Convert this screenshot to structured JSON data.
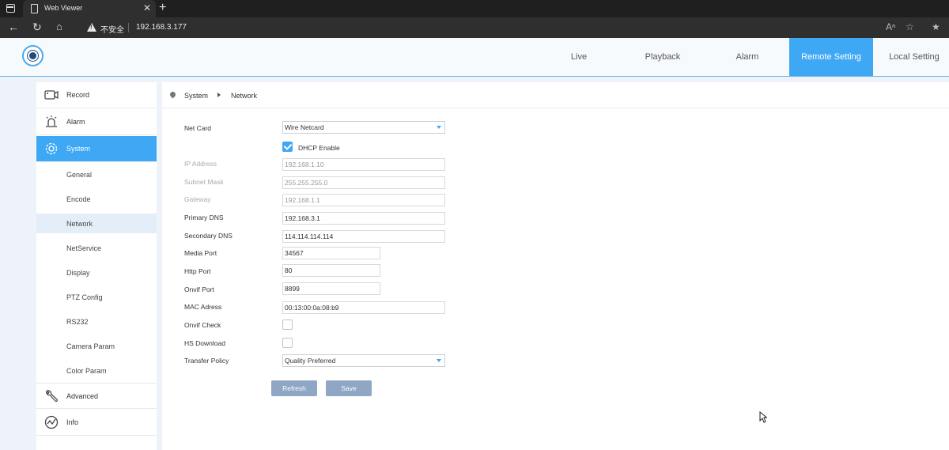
{
  "browser": {
    "tab_title": "Web Viewer",
    "tab_close": "✕",
    "new_tab": "+",
    "security_label": "不安全",
    "url": "192.168.3.177"
  },
  "header": {
    "tabs": [
      {
        "label": "Live"
      },
      {
        "label": "Playback"
      },
      {
        "label": "Alarm"
      },
      {
        "label": "Remote Setting"
      },
      {
        "label": "Local Setting"
      }
    ],
    "active_tab": "Remote Setting",
    "accent_color": "#3fa8f4"
  },
  "sidebar": {
    "items": [
      {
        "label": "Record",
        "icon": "camera-icon"
      },
      {
        "label": "Alarm",
        "icon": "alarm-icon"
      },
      {
        "label": "System",
        "icon": "gear-icon"
      },
      {
        "label": "Advanced",
        "icon": "wrench-icon"
      },
      {
        "label": "Info",
        "icon": "info-chart-icon"
      }
    ],
    "system_subitems": [
      {
        "label": "General"
      },
      {
        "label": "Encode"
      },
      {
        "label": "Network"
      },
      {
        "label": "NetService"
      },
      {
        "label": "Display"
      },
      {
        "label": "PTZ Config"
      },
      {
        "label": "RS232"
      },
      {
        "label": "Camera Param"
      },
      {
        "label": "Color Param"
      }
    ],
    "active_subitem": "Network"
  },
  "breadcrumb": {
    "level1": "System",
    "level2": "Network"
  },
  "form": {
    "net_card_label": "Net Card",
    "net_card_value": "Wire Netcard",
    "dhcp_label": "DHCP Enable",
    "dhcp_checked": true,
    "ip_label": "IP Address",
    "ip_value": "192.168.1.10",
    "mask_label": "Subnet Mask",
    "mask_value": "255.255.255.0",
    "gateway_label": "Gateway",
    "gateway_value": "192.168.1.1",
    "dns1_label": "Primary DNS",
    "dns1_value": "192.168.3.1",
    "dns2_label": "Secondary DNS",
    "dns2_value": "114.114.114.114",
    "media_port_label": "Media Port",
    "media_port_value": "34567",
    "http_port_label": "Http Port",
    "http_port_value": "80",
    "onvif_port_label": "Onvif Port",
    "onvif_port_value": "8899",
    "mac_label": "MAC Adress",
    "mac_value": "00:13:00:0a:08:b9",
    "onvif_check_label": "Onvif Check",
    "onvif_check_checked": false,
    "hs_download_label": "HS Download",
    "hs_download_checked": false,
    "transfer_label": "Transfer Policy",
    "transfer_value": "Quality Preferred",
    "refresh_label": "Refresh",
    "save_label": "Save"
  }
}
